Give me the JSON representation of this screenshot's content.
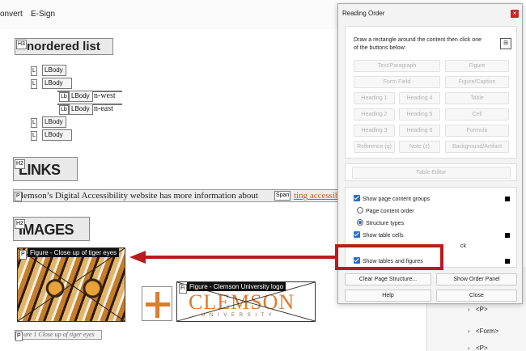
{
  "menubar": {
    "convert": "onvert",
    "esign": "E-Sign"
  },
  "doc": {
    "h3_tag": "H3",
    "h3_text": "nordered list",
    "list_boxes": [
      {
        "tag": "L",
        "label": "LBody",
        "suffix": ""
      },
      {
        "tag": "L",
        "label": "LBody",
        "suffix": ""
      },
      {
        "tag": "Lb",
        "label": "LBody",
        "suffix": "n-west"
      },
      {
        "tag": "Lb",
        "label": "LBody",
        "suffix": "n-east"
      },
      {
        "tag": "L",
        "label": "LBody",
        "suffix": ""
      },
      {
        "tag": "L",
        "label": "LBody",
        "suffix": ""
      }
    ],
    "h2_links_tag": "H2",
    "h2_links_text": "LINKS",
    "p_tag": "P",
    "paragraph": "lemson’s Digital Accessibility website has more information about",
    "span_tag": "Span",
    "link_text": "ting accessib",
    "h2_images_tag": "H2",
    "h2_images_text": "IMAGES",
    "fig1_label": "Figure - Close up of tiger eyes",
    "fig1_tag": "P",
    "p_small_tag": "P",
    "fig2_label": "Figure - Clemson University logo",
    "fig2_tag": "Fi",
    "clemson_text": "CLEMSON",
    "university_text": "U N I V E R S I T Y",
    "caption_tag": "P",
    "caption": "ure 1 Close up of tiger eyes"
  },
  "tree": {
    "items": [
      "<P>",
      "<Form>",
      "<P>"
    ]
  },
  "dialog": {
    "title": "Reading Order",
    "close": "×",
    "instructions": "Draw a rectangle around the content then click one of the buttons below:",
    "buttons": [
      "Text/Paragraph",
      "Figure",
      "Form Field",
      "Figure/Caption",
      "Heading 1",
      "Heading 4",
      "Table",
      "Heading 2",
      "Heading 5",
      "Cell",
      "Heading 3",
      "Heading 6",
      "Formula",
      "Reference (q)",
      "Note (z)",
      "Background/Artifact"
    ],
    "table_editor": "Table Editor",
    "show_groups": "Show page content groups",
    "page_order": "Page content order",
    "structure_types": "Structure types",
    "show_cells": "Show table cells",
    "show_tables": "Show tables and figures",
    "clear": "Clear Page Structure...",
    "show_order": "Show Order Panel",
    "help": "Help",
    "close_btn": "Close",
    "hidden_word": "ck"
  },
  "colors": {
    "accent": "#2a6ccf",
    "highlight": "#b81c1c",
    "clemson_orange": "#e07b2e"
  }
}
